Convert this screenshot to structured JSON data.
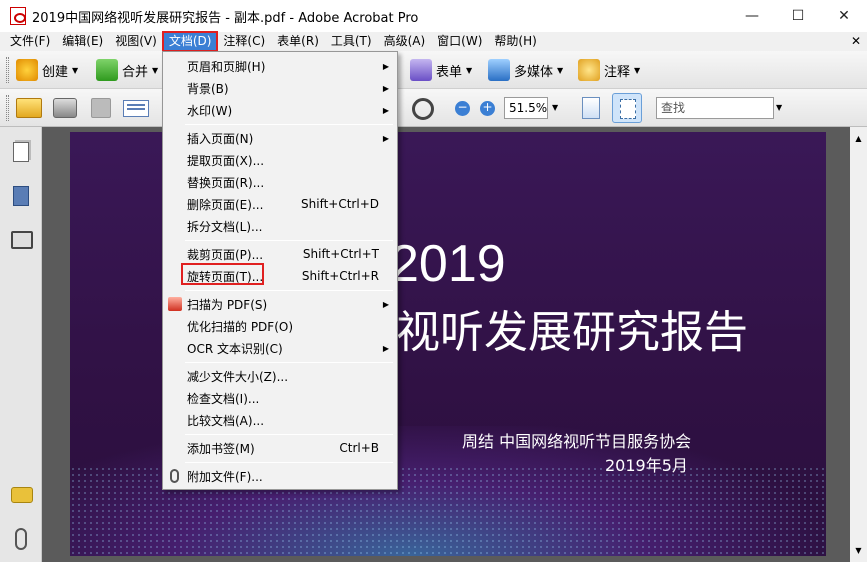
{
  "window": {
    "title": "2019中国网络视听发展研究报告 - 副本.pdf - Adobe Acrobat Pro",
    "minimize": "—",
    "maximize": "☐",
    "close": "✕"
  },
  "menubar": {
    "items": [
      "文件(F)",
      "编辑(E)",
      "视图(V)",
      "文档(D)",
      "注释(C)",
      "表单(R)",
      "工具(T)",
      "高级(A)",
      "窗口(W)",
      "帮助(H)"
    ],
    "active_index": 3,
    "close_glyph": "✕"
  },
  "toolbar1": {
    "create": "创建",
    "combine": "合并",
    "forms": "表单",
    "multimedia": "多媒体",
    "comment": "注释"
  },
  "toolbar2": {
    "zoom_value": "51.5%",
    "search_placeholder": "查找"
  },
  "document_menu": {
    "items": [
      {
        "label": "页眉和页脚(H)",
        "shortcut": "",
        "submenu": true
      },
      {
        "label": "背景(B)",
        "shortcut": "",
        "submenu": true
      },
      {
        "label": "水印(W)",
        "shortcut": "",
        "submenu": true
      },
      {
        "label": "插入页面(N)",
        "shortcut": "",
        "submenu": true
      },
      {
        "label": "提取页面(X)...",
        "shortcut": "",
        "submenu": false
      },
      {
        "label": "替换页面(R)...",
        "shortcut": "",
        "submenu": false
      },
      {
        "label": "删除页面(E)...",
        "shortcut": "Shift+Ctrl+D",
        "submenu": false
      },
      {
        "label": "拆分文档(L)...",
        "shortcut": "",
        "submenu": false
      },
      {
        "label": "裁剪页面(P)...",
        "shortcut": "Shift+Ctrl+T",
        "submenu": false
      },
      {
        "label": "旋转页面(T)...",
        "shortcut": "Shift+Ctrl+R",
        "submenu": false
      },
      {
        "label": "扫描为 PDF(S)",
        "shortcut": "",
        "submenu": true
      },
      {
        "label": "优化扫描的 PDF(O)",
        "shortcut": "",
        "submenu": false
      },
      {
        "label": "OCR 文本识别(C)",
        "shortcut": "",
        "submenu": true
      },
      {
        "label": "减少文件大小(Z)...",
        "shortcut": "",
        "submenu": false
      },
      {
        "label": "检查文档(I)...",
        "shortcut": "",
        "submenu": false
      },
      {
        "label": "比较文档(A)...",
        "shortcut": "",
        "submenu": false
      },
      {
        "label": "添加书签(M)",
        "shortcut": "Ctrl+B",
        "submenu": false
      },
      {
        "label": "附加文件(F)...",
        "shortcut": "",
        "submenu": false
      }
    ],
    "highlighted": "旋转页面(T)..."
  },
  "page": {
    "year": "2019",
    "title": "视听发展研究报告",
    "author": "周结  中国网络视听节目服务协会",
    "date": "2019年5月"
  },
  "colors": {
    "menu_active": "#3b7fd4",
    "highlight_border": "#e02020",
    "page_bg": "#3a1857"
  }
}
